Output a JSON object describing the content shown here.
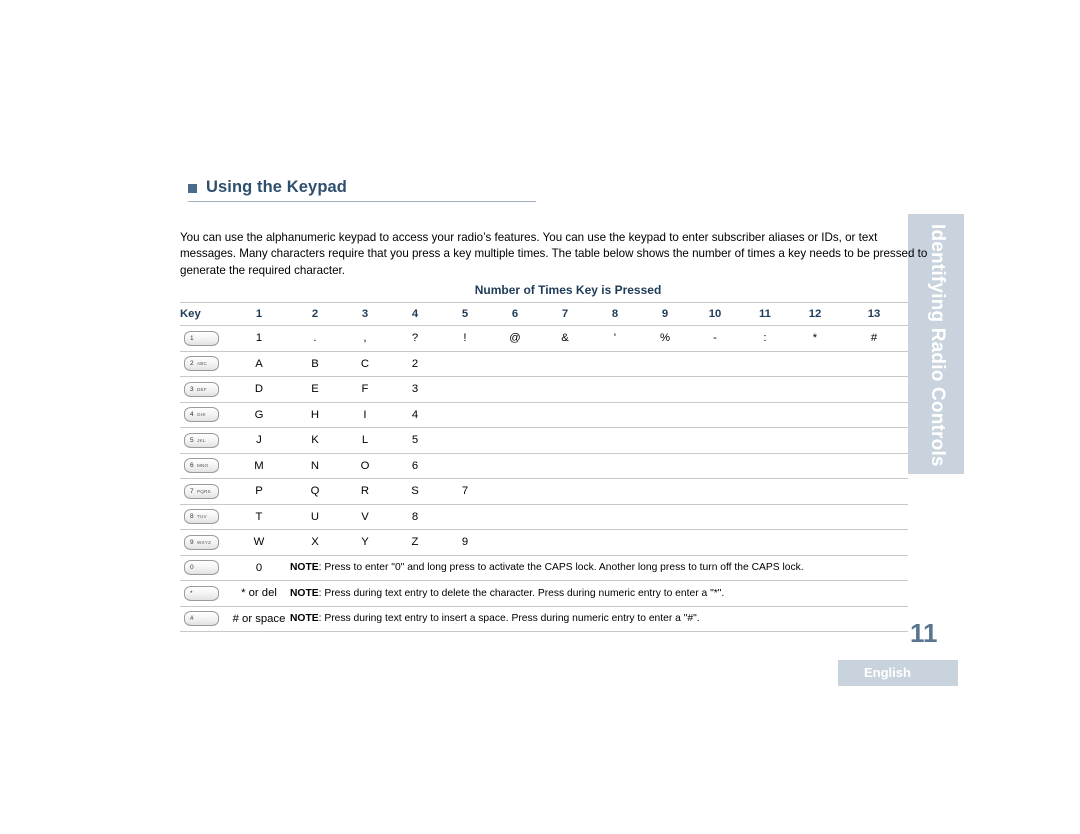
{
  "side_tab": {
    "label": "Identifying Radio Controls"
  },
  "heading": {
    "title": "Using the Keypad"
  },
  "intro": {
    "text": "You can use the alphanumeric keypad to access your radio’s features. You can use the keypad to enter subscriber aliases or IDs, or text messages. Many characters require that you press a key multiple times. The table below shows the number of times a key needs to be pressed to generate the required character."
  },
  "table": {
    "span_header": "Number of Times Key is Pressed",
    "key_column_header": "Key",
    "column_headers": [
      "1",
      "2",
      "3",
      "4",
      "5",
      "6",
      "7",
      "8",
      "9",
      "10",
      "11",
      "12",
      "13"
    ],
    "rows": [
      {
        "key_main": "1",
        "key_sub": "",
        "type": "chars",
        "values": [
          "1",
          ".",
          ",",
          "?",
          "!",
          "@",
          "&",
          "'",
          "%",
          "-",
          ":",
          "*",
          "#"
        ]
      },
      {
        "key_main": "2",
        "key_sub": "ABC",
        "type": "chars",
        "values": [
          "A",
          "B",
          "C",
          "2",
          "",
          "",
          "",
          "",
          "",
          "",
          "",
          "",
          ""
        ]
      },
      {
        "key_main": "3",
        "key_sub": "DEF",
        "type": "chars",
        "values": [
          "D",
          "E",
          "F",
          "3",
          "",
          "",
          "",
          "",
          "",
          "",
          "",
          "",
          ""
        ]
      },
      {
        "key_main": "4",
        "key_sub": "GHI",
        "type": "chars",
        "values": [
          "G",
          "H",
          "I",
          "4",
          "",
          "",
          "",
          "",
          "",
          "",
          "",
          "",
          ""
        ]
      },
      {
        "key_main": "5",
        "key_sub": "JKL",
        "type": "chars",
        "values": [
          "J",
          "K",
          "L",
          "5",
          "",
          "",
          "",
          "",
          "",
          "",
          "",
          "",
          ""
        ]
      },
      {
        "key_main": "6",
        "key_sub": "MNO",
        "type": "chars",
        "values": [
          "M",
          "N",
          "O",
          "6",
          "",
          "",
          "",
          "",
          "",
          "",
          "",
          "",
          ""
        ]
      },
      {
        "key_main": "7",
        "key_sub": "PQRS",
        "type": "chars",
        "values": [
          "P",
          "Q",
          "R",
          "S",
          "7",
          "",
          "",
          "",
          "",
          "",
          "",
          "",
          ""
        ]
      },
      {
        "key_main": "8",
        "key_sub": "TUV",
        "type": "chars",
        "values": [
          "T",
          "U",
          "V",
          "8",
          "",
          "",
          "",
          "",
          "",
          "",
          "",
          "",
          ""
        ]
      },
      {
        "key_main": "9",
        "key_sub": "WXYZ",
        "type": "chars",
        "values": [
          "W",
          "X",
          "Y",
          "Z",
          "9",
          "",
          "",
          "",
          "",
          "",
          "",
          "",
          ""
        ]
      },
      {
        "key_main": "0",
        "key_sub": "",
        "type": "note",
        "first_value": "0",
        "note_bold": "NOTE",
        "note_text": ": Press to enter \"0\" and long press to activate the CAPS lock. Another long press to turn off the CAPS lock."
      },
      {
        "key_main": "*",
        "key_sub": "",
        "type": "note",
        "first_value": "* or del",
        "note_bold": "NOTE",
        "note_text": ": Press during text entry to delete the character. Press during numeric entry to enter a \"*\"."
      },
      {
        "key_main": "#",
        "key_sub": "",
        "type": "note",
        "first_value": "# or space",
        "note_bold": "NOTE",
        "note_text": ": Press during text entry to insert a space. Press during numeric entry to enter a \"#\"."
      }
    ]
  },
  "footer": {
    "page_number": "11",
    "language": "English"
  }
}
